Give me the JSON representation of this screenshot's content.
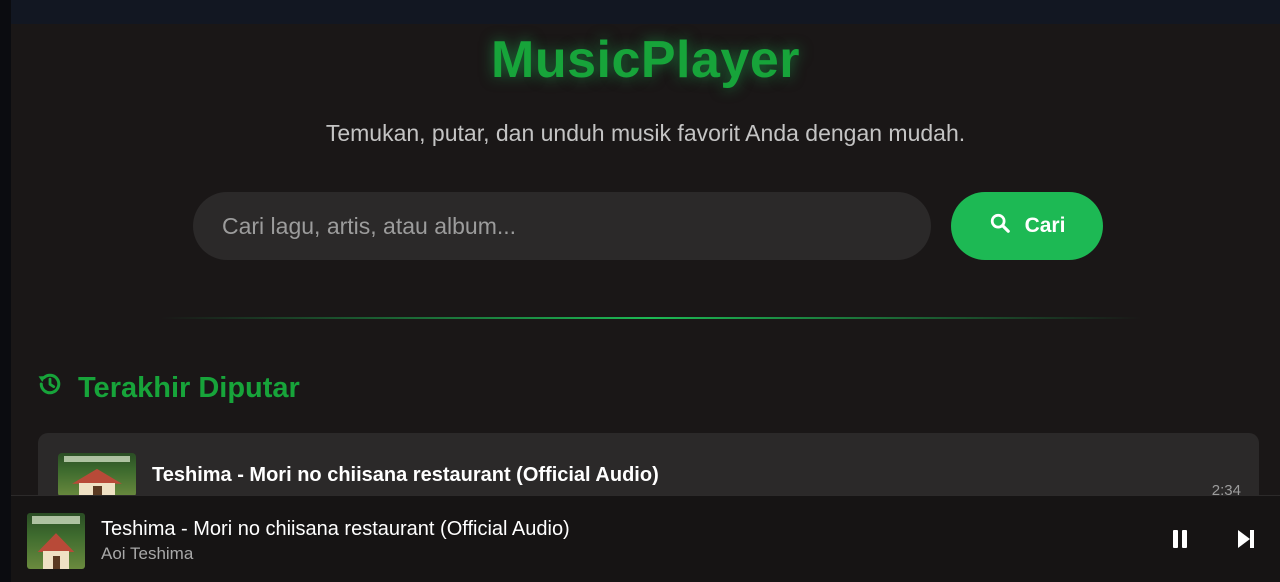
{
  "app": {
    "brand": "MusicPlayer",
    "tagline": "Temukan, putar, dan unduh musik favorit Anda dengan mudah."
  },
  "search": {
    "placeholder": "Cari lagu, artis, atau album...",
    "button_label": "Cari",
    "button_icon": "search-icon"
  },
  "recent": {
    "section_icon": "history-icon",
    "title": "Terakhir Diputar",
    "items": [
      {
        "title": "Teshima - Mori no chiisana restaurant (Official Audio)",
        "duration": "2:34"
      }
    ]
  },
  "now_playing": {
    "title": "Teshima - Mori no chiisana restaurant (Official Audio)",
    "artist": "Aoi Teshima",
    "controls": [
      "pause-icon",
      "skip-next-icon"
    ]
  },
  "colors": {
    "accent": "#1db954",
    "brand_green": "#17a43a",
    "background": "#1a1717",
    "surface": "#2b2929",
    "player_bar": "#161414"
  }
}
